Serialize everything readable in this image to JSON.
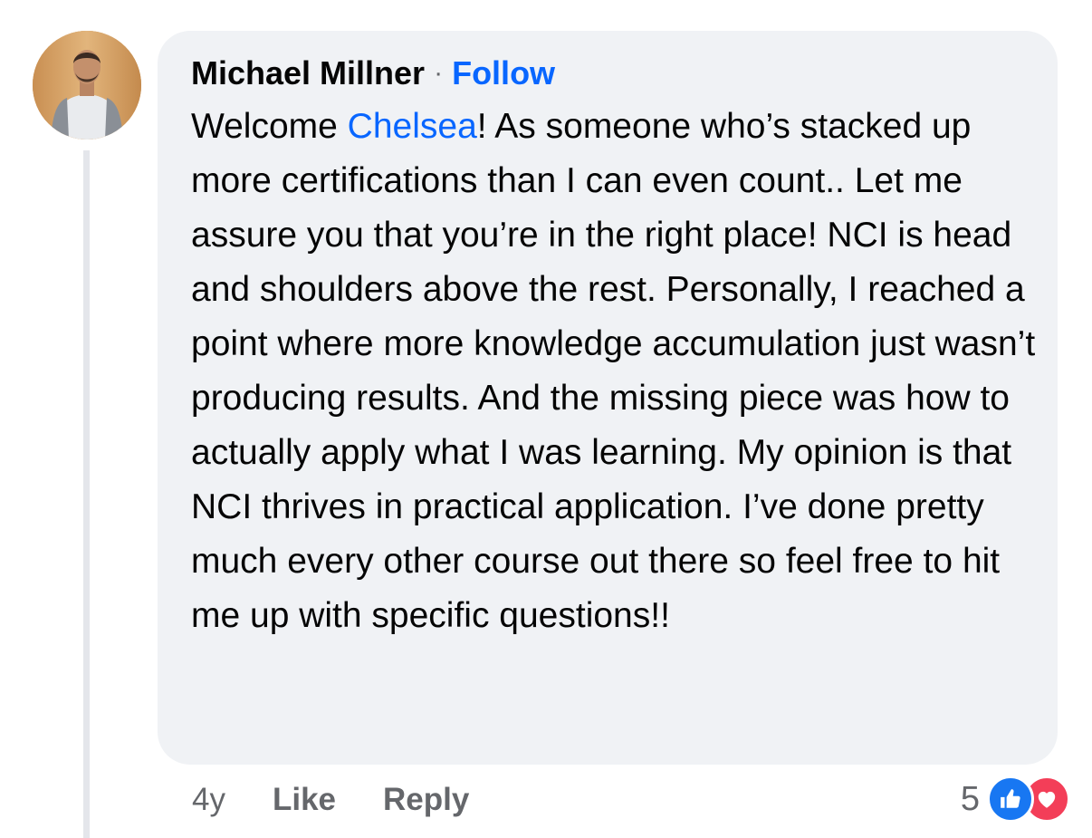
{
  "comment": {
    "author": "Michael Millner",
    "separator": "·",
    "follow_label": "Follow",
    "text_before_mention": "Welcome ",
    "mention": "Chelsea",
    "text_after_mention": "! As someone who’s stacked up more certifications than I can even count.. Let me assure you that you’re in the right place! NCI is head and shoulders above the rest. Personally, I reached a point where more knowledge accumulation just wasn’t producing results. And the missing piece was how to actually apply what I was learning. My opinion is that NCI thrives in practical application. I’ve done pretty much every other course out there so feel free to hit me up with specific questions!!"
  },
  "actions": {
    "time": "4y",
    "like_label": "Like",
    "reply_label": "Reply"
  },
  "reactions": {
    "count": "5",
    "icons": [
      "thumbs-up-icon",
      "heart-icon"
    ],
    "colors": {
      "like": "#1877f2",
      "love": "#f33e58",
      "link": "#0866ff"
    }
  },
  "avatar": {
    "icon": "avatar"
  }
}
